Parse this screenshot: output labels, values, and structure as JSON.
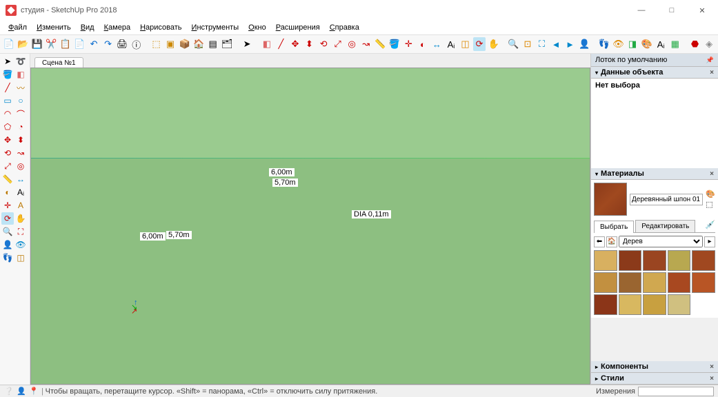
{
  "window": {
    "title": "студия - SketchUp Pro 2018"
  },
  "menu": [
    "Файл",
    "Изменить",
    "Вид",
    "Камера",
    "Нарисовать",
    "Инструменты",
    "Окно",
    "Расширения",
    "Справка"
  ],
  "scene_tab": "Сцена №1",
  "dims": {
    "top1": "6,00m",
    "top2": "5,70m",
    "left1": "6,00m",
    "left2": "5,70m",
    "dia": "DIA 0,11m"
  },
  "tray": {
    "title": "Лоток по умолчанию",
    "entity": {
      "header": "Данные объекта",
      "body": "Нет выбора"
    },
    "materials": {
      "header": "Материалы",
      "current_name": "Деревянный шпон 01",
      "tab_select": "Выбрать",
      "tab_edit": "Редактировать",
      "category": "Дерев",
      "swatches": [
        "#d8b060",
        "#8b3a1a",
        "#9a4521",
        "#b8a850",
        "#a04820",
        "#c29040",
        "#9a6530",
        "#d0a850",
        "#a84820",
        "#b85525",
        "#8b3518",
        "#d8b860",
        "#c8a040",
        "#d0c080"
      ]
    },
    "components": "Компоненты",
    "styles": "Стили"
  },
  "status": {
    "hint": "Чтобы вращать, перетащите курсор. «Shift» = панорама, «Ctrl» = отключить силу притяжения.",
    "meas_label": "Измерения"
  }
}
